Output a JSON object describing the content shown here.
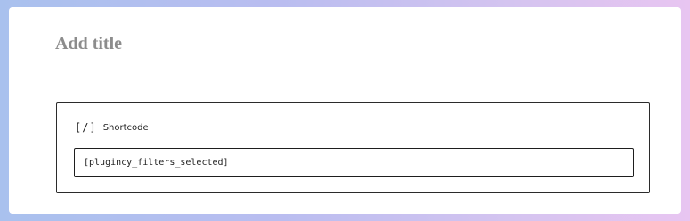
{
  "editor": {
    "title_placeholder": "Add title"
  },
  "shortcode_block": {
    "icon": "shortcode-icon",
    "icon_glyph": "[/]",
    "label": "Shortcode",
    "value": "[plugincy_filters_selected]"
  },
  "colors": {
    "gradient_start": "#a9c1ee",
    "gradient_end": "#e8c5f1",
    "title_placeholder": "#8c8c8c",
    "border": "#1e1e1e"
  }
}
